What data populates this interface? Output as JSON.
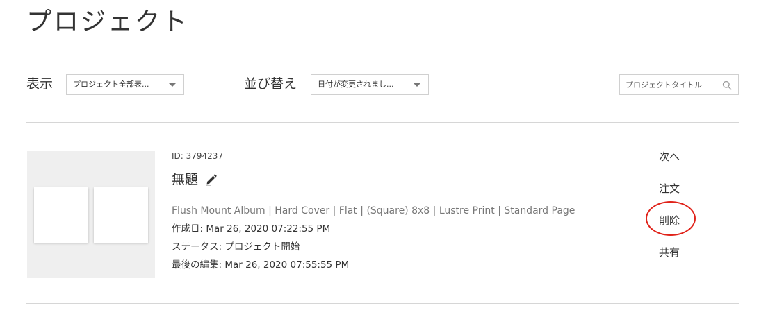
{
  "page": {
    "title": "プロジェクト"
  },
  "filters": {
    "display_label": "表示",
    "display_value": "プロジェクト全部表...",
    "sort_label": "並び替え",
    "sort_value": "日付が変更されまし...",
    "search_placeholder": "プロジェクトタイトル",
    "search_value": ""
  },
  "project": {
    "id_text": "ID: 3794237",
    "title": "無題",
    "specs": "Flush Mount Album | Hard Cover | Flat | (Square) 8x8 | Lustre Print | Standard Page",
    "created": "作成日: Mar 26, 2020 07:22:55 PM",
    "status": "ステータス: プロジェクト開始",
    "last_edited": "最後の編集: Mar 26, 2020 07:55:55 PM"
  },
  "actions": {
    "next": "次へ",
    "order": "注文",
    "delete": "削除",
    "share": "共有"
  },
  "colors": {
    "highlight": "#e0231a",
    "thumbnail_bg": "#efefef",
    "divider": "#d6d6d6"
  },
  "icons": {
    "edit": "pencil-icon",
    "search": "search-icon",
    "dropdown": "chevron-down-icon"
  }
}
